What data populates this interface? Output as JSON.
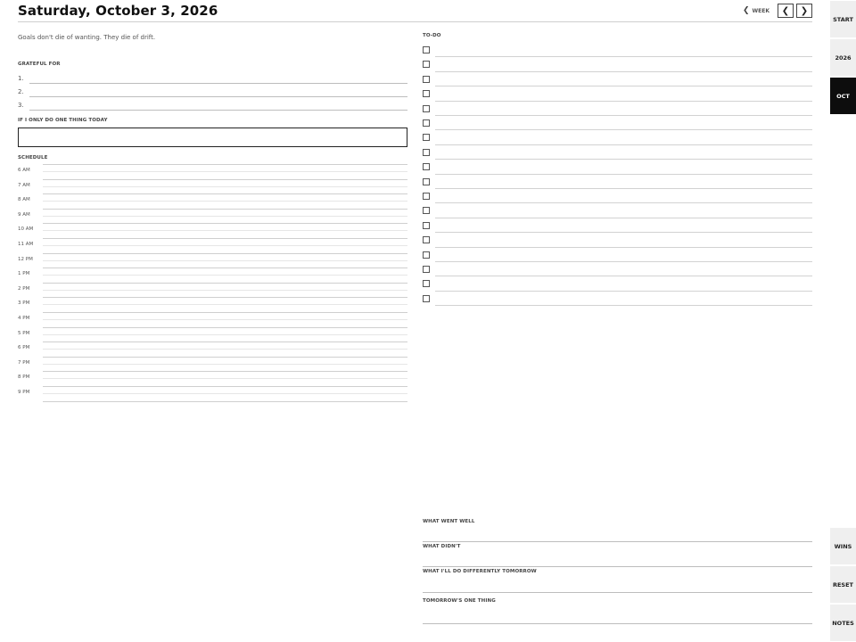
{
  "header": {
    "title": "Saturday, October 3, 2026",
    "week_label": "WEEK",
    "prev_glyph": "❮",
    "next_glyph": "❯",
    "week_glyph": "❮"
  },
  "quote": "Goals don't die of wanting. They die of drift.",
  "grateful": {
    "label": "GRATEFUL FOR",
    "items": [
      "1.",
      "2.",
      "3."
    ]
  },
  "one_thing": {
    "label": "IF I ONLY DO ONE THING TODAY",
    "value": "",
    "placeholder": ""
  },
  "schedule": {
    "label": "SCHEDULE",
    "hours": [
      "6 AM",
      "7 AM",
      "8 AM",
      "9 AM",
      "10 AM",
      "11 AM",
      "12 PM",
      "1 PM",
      "2 PM",
      "3 PM",
      "4 PM",
      "5 PM",
      "6 PM",
      "7 PM",
      "8 PM",
      "9 PM"
    ]
  },
  "todo": {
    "label": "TO-DO",
    "count": 18
  },
  "reflection": {
    "went_well": "WHAT WENT WELL",
    "didnt": "WHAT DIDN'T",
    "differently": "WHAT I'LL DO DIFFERENTLY TOMORROW",
    "tomorrow": "TOMORROW'S ONE THING"
  },
  "sidebar": {
    "top": [
      "START",
      "2026",
      "OCT"
    ],
    "active": "OCT",
    "bottom": [
      "WINS",
      "RESET",
      "NOTES"
    ]
  },
  "colors": {
    "active_tab": "#0d0d0d",
    "tab_bg": "#efefef"
  }
}
